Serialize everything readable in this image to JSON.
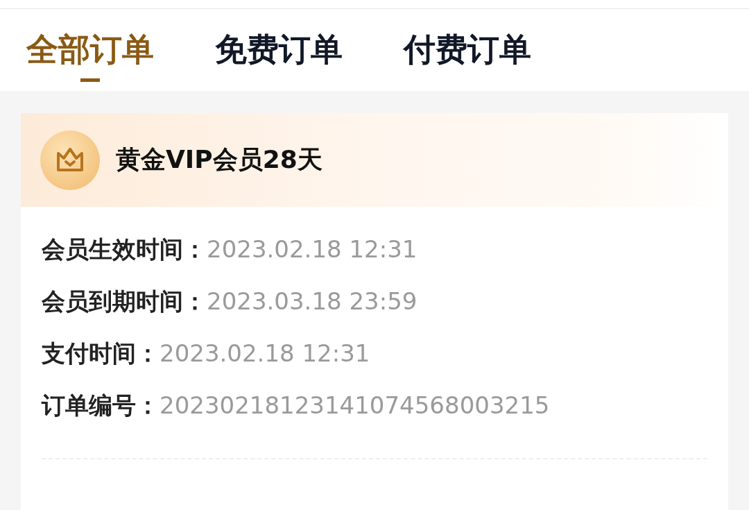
{
  "tabs": [
    {
      "label": "全部订单",
      "selected": true
    },
    {
      "label": "免费订单",
      "selected": false
    },
    {
      "label": "付费订单",
      "selected": false
    }
  ],
  "order": {
    "title": "黄金VIP会员28天",
    "fields": [
      {
        "label": "会员生效时间：",
        "value": "2023.02.18 12:31"
      },
      {
        "label": "会员到期时间：",
        "value": "2023.03.18 23:59"
      },
      {
        "label": "支付时间：",
        "value": "2023.02.18 12:31"
      },
      {
        "label": "订单编号：",
        "value": "20230218123141074568003215"
      }
    ]
  }
}
